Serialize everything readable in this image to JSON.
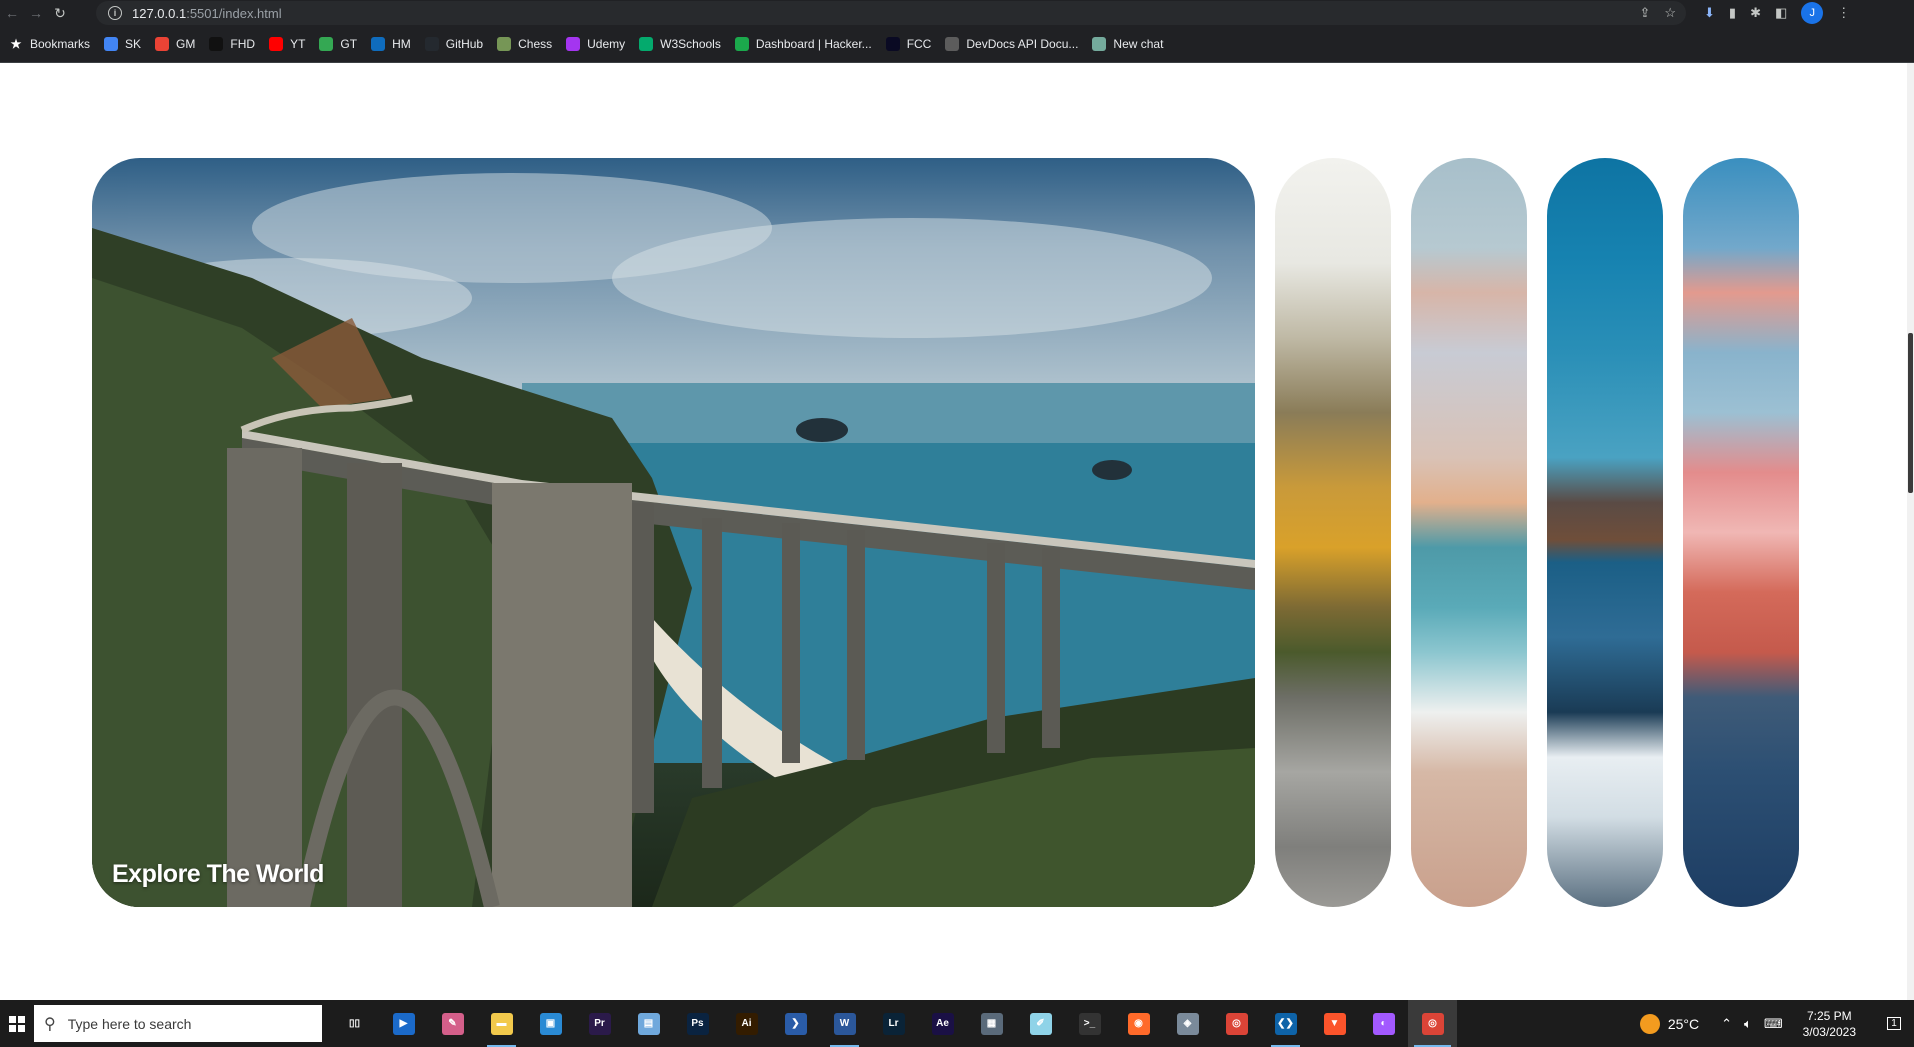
{
  "browser": {
    "url_host": "127.0.0.1",
    "url_path": ":5501/index.html",
    "profile_initial": "J"
  },
  "bookmarks": [
    {
      "label": "Bookmarks",
      "icon": "star-icon",
      "color": "#ffffff"
    },
    {
      "label": "SK",
      "icon": "sk-icon",
      "color": "#4285f4"
    },
    {
      "label": "GM",
      "icon": "gmail-icon",
      "color": "#ea4335"
    },
    {
      "label": "FHD",
      "icon": "fhd-icon",
      "color": "#111111"
    },
    {
      "label": "YT",
      "icon": "youtube-icon",
      "color": "#ff0000"
    },
    {
      "label": "GT",
      "icon": "gt-icon",
      "color": "#34a853"
    },
    {
      "label": "HM",
      "icon": "outlook-icon",
      "color": "#0f6cbd"
    },
    {
      "label": "GitHub",
      "icon": "github-icon",
      "color": "#24292f"
    },
    {
      "label": "Chess",
      "icon": "chess-icon",
      "color": "#769656"
    },
    {
      "label": "Udemy",
      "icon": "udemy-icon",
      "color": "#a435f0"
    },
    {
      "label": "W3Schools",
      "icon": "w3schools-icon",
      "color": "#04aa6d"
    },
    {
      "label": "Dashboard | Hacker...",
      "icon": "hackerrank-icon",
      "color": "#1ba94c"
    },
    {
      "label": "FCC",
      "icon": "fcc-icon",
      "color": "#0a0a23"
    },
    {
      "label": "DevDocs API Docu...",
      "icon": "devdocs-icon",
      "color": "#5c5c5c"
    },
    {
      "label": "New chat",
      "icon": "chatgpt-icon",
      "color": "#74aa9c"
    }
  ],
  "page": {
    "main_card_title": "Explore The World",
    "cards": [
      {
        "name": "forest"
      },
      {
        "name": "beach"
      },
      {
        "name": "city"
      },
      {
        "name": "mountain"
      }
    ]
  },
  "taskbar": {
    "search_placeholder": "Type here to search",
    "apps": [
      {
        "name": "task-view-icon",
        "glyph": "▯▯",
        "color": "#1c1c1c",
        "state": ""
      },
      {
        "name": "media-player-icon",
        "glyph": "▶",
        "color": "#1b6ac9",
        "state": ""
      },
      {
        "name": "paint-icon",
        "glyph": "✎",
        "color": "#d45f8a",
        "state": ""
      },
      {
        "name": "file-explorer-icon",
        "glyph": "▬",
        "color": "#f2c94c",
        "state": "open"
      },
      {
        "name": "photos-icon",
        "glyph": "▣",
        "color": "#2a8ad4",
        "state": ""
      },
      {
        "name": "premiere-icon",
        "glyph": "Pr",
        "color": "#2b1a4a",
        "state": ""
      },
      {
        "name": "document-icon",
        "glyph": "▤",
        "color": "#6fa8dc",
        "state": ""
      },
      {
        "name": "photoshop-icon",
        "glyph": "Ps",
        "color": "#0a2340",
        "state": ""
      },
      {
        "name": "illustrator-icon",
        "glyph": "Ai",
        "color": "#331c00",
        "state": ""
      },
      {
        "name": "powershell-icon",
        "glyph": "❯",
        "color": "#2a5ca8",
        "state": ""
      },
      {
        "name": "word-icon",
        "glyph": "W",
        "color": "#2b579a",
        "state": "open"
      },
      {
        "name": "lightroom-icon",
        "glyph": "Lr",
        "color": "#0a2337",
        "state": ""
      },
      {
        "name": "after-effects-icon",
        "glyph": "Ae",
        "color": "#1a1045",
        "state": ""
      },
      {
        "name": "calculator-icon",
        "glyph": "▦",
        "color": "#5a6a7a",
        "state": ""
      },
      {
        "name": "notepad-icon",
        "glyph": "✐",
        "color": "#8fd3e8",
        "state": ""
      },
      {
        "name": "terminal-icon",
        "glyph": ">_",
        "color": "#333333",
        "state": ""
      },
      {
        "name": "firefox-icon",
        "glyph": "◉",
        "color": "#ff6a2a",
        "state": ""
      },
      {
        "name": "settings-app-icon",
        "glyph": "◈",
        "color": "#7a8a9a",
        "state": ""
      },
      {
        "name": "chrome-icon",
        "glyph": "◎",
        "color": "#db4437",
        "state": ""
      },
      {
        "name": "vscode-icon",
        "glyph": "❮❯",
        "color": "#0e63a8",
        "state": "open"
      },
      {
        "name": "brave-icon",
        "glyph": "▼",
        "color": "#fb542b",
        "state": ""
      },
      {
        "name": "figma-icon",
        "glyph": "◐",
        "color": "#a259ff",
        "state": ""
      },
      {
        "name": "chrome-active-icon",
        "glyph": "◎",
        "color": "#db4437",
        "state": "active"
      }
    ],
    "weather_temp": "25°C",
    "time": "7:25 PM",
    "date": "3/03/2023",
    "notification_count": "1"
  }
}
